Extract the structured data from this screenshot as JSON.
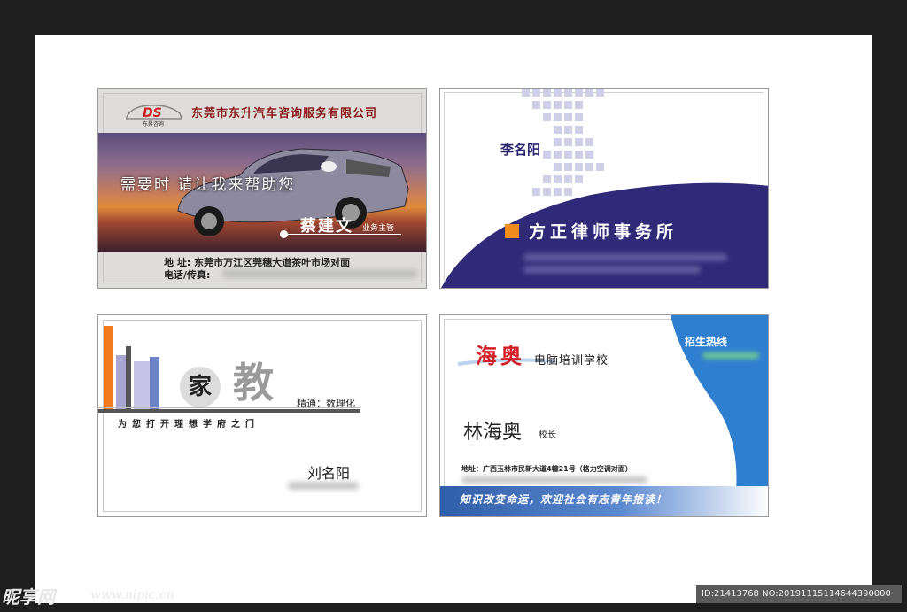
{
  "card1": {
    "logo": "DS",
    "logo_sub": "东昇咨询",
    "company": "东莞市东升汽车咨询服务有限公司",
    "slogan": "需要时  请让我来帮助您",
    "name": "蔡建文",
    "title": "业务主管",
    "address_label": "地      址:",
    "address": "东莞市万江区莞穗大道茶叶市场对面",
    "phone_label": "电话/传真:"
  },
  "card2": {
    "name": "李名阳",
    "firm": "方正律师事务所",
    "colors": {
      "accent": "#2a2670",
      "orange": "#f08c1e"
    }
  },
  "card3": {
    "char1": "家",
    "char2": "教",
    "subject": "精通：数理化",
    "motto": "为您打开理想学府之门",
    "name": "刘名阳"
  },
  "card4": {
    "brand": "海奥",
    "school": "电脑培训学校",
    "hotline": "招生热线",
    "name": "林海奥",
    "title": "校长",
    "address": "地址：广西玉林市民新大道4幢21号（格力空调对面）",
    "footer": "知识改变命运，欢迎社会有志青年报读！"
  },
  "watermark": {
    "logo": "昵享网",
    "url": "www.nipic.cn",
    "id": "ID:21413768 NO:20191115114644390000"
  }
}
